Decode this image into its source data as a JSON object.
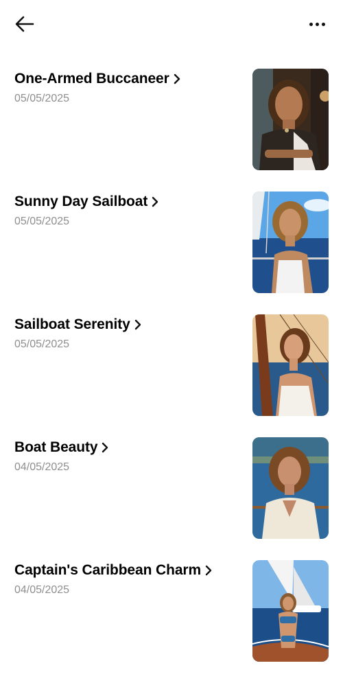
{
  "header": {
    "back_icon": "arrow-left-icon",
    "more_icon": "more-horizontal-icon"
  },
  "items": [
    {
      "title": "One-Armed Buccaneer",
      "date": "05/05/2025",
      "thumb": "pirate-woman-portrait"
    },
    {
      "title": "Sunny Day Sailboat",
      "date": "05/05/2025",
      "thumb": "woman-on-sailboat-white-top"
    },
    {
      "title": "Sailboat Serenity",
      "date": "05/05/2025",
      "thumb": "woman-at-mast-sunset"
    },
    {
      "title": "Boat Beauty",
      "date": "04/05/2025",
      "thumb": "woman-white-dress-on-boat"
    },
    {
      "title": "Captain's Caribbean Charm",
      "date": "04/05/2025",
      "thumb": "woman-bikini-sailboat"
    }
  ]
}
